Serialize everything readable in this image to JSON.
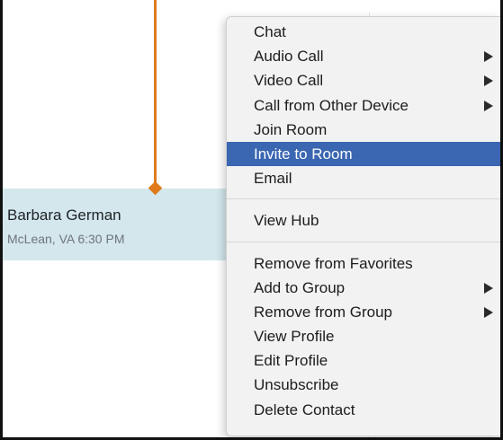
{
  "contact": {
    "name": "Barbara German",
    "details": "McLean, VA 6:30 PM"
  },
  "context_menu": {
    "groups": [
      [
        {
          "label": "Chat",
          "submenu": false
        },
        {
          "label": "Audio Call",
          "submenu": true
        },
        {
          "label": "Video Call",
          "submenu": true
        },
        {
          "label": "Call from Other Device",
          "submenu": true
        },
        {
          "label": "Join Room",
          "submenu": false
        },
        {
          "label": "Invite to Room",
          "submenu": false,
          "highlighted": true
        },
        {
          "label": "Email",
          "submenu": false
        }
      ],
      [
        {
          "label": "View Hub",
          "submenu": false
        }
      ],
      [
        {
          "label": "Remove from Favorites",
          "submenu": false
        },
        {
          "label": "Add to Group",
          "submenu": true
        },
        {
          "label": "Remove from Group",
          "submenu": true
        },
        {
          "label": "View Profile",
          "submenu": false
        },
        {
          "label": "Edit Profile",
          "submenu": false
        },
        {
          "label": "Unsubscribe",
          "submenu": false
        },
        {
          "label": "Delete Contact",
          "submenu": false
        }
      ]
    ]
  },
  "colors": {
    "highlight": "#3a66b2",
    "callout": "#e07b1c",
    "selected_row": "#d3e7ec"
  }
}
